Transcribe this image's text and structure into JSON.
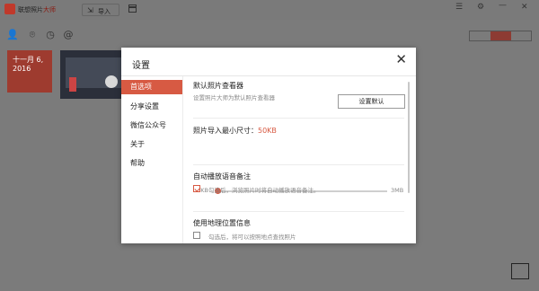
{
  "app": {
    "title_part1": "联想照片",
    "title_part2": "大师",
    "import_label": "导入"
  },
  "colors": {
    "accent": "#d75a43",
    "date_card": "#9e3b2f"
  },
  "window_controls": [
    "menu-icon",
    "settings-icon",
    "minimize-icon",
    "close-icon"
  ],
  "date_card": {
    "line1": "十一月 6,",
    "line2": "2016"
  },
  "dialog": {
    "title": "设置",
    "nav": [
      {
        "label": "首选项",
        "active": true
      },
      {
        "label": "分享设置"
      },
      {
        "label": "微信公众号"
      },
      {
        "label": "关于"
      },
      {
        "label": "帮助"
      }
    ],
    "default_viewer": {
      "title": "默认照片查看器",
      "desc": "设置照片大师为默认照片查看器",
      "button": "设置默认"
    },
    "import_size": {
      "title": "照片导入最小尺寸：",
      "value": "50KB",
      "min_label": "50KB",
      "max_label": "3MB",
      "position": 0
    },
    "voice_note": {
      "title": "自动播放语音备注",
      "checkbox_label": "勾选后，浏览照片时将自动播放语音备注。",
      "checked": true
    },
    "location": {
      "title": "使用地理位置信息",
      "checkbox_label": "勾选后，将可以按照地点查找照片",
      "checked": false
    }
  }
}
